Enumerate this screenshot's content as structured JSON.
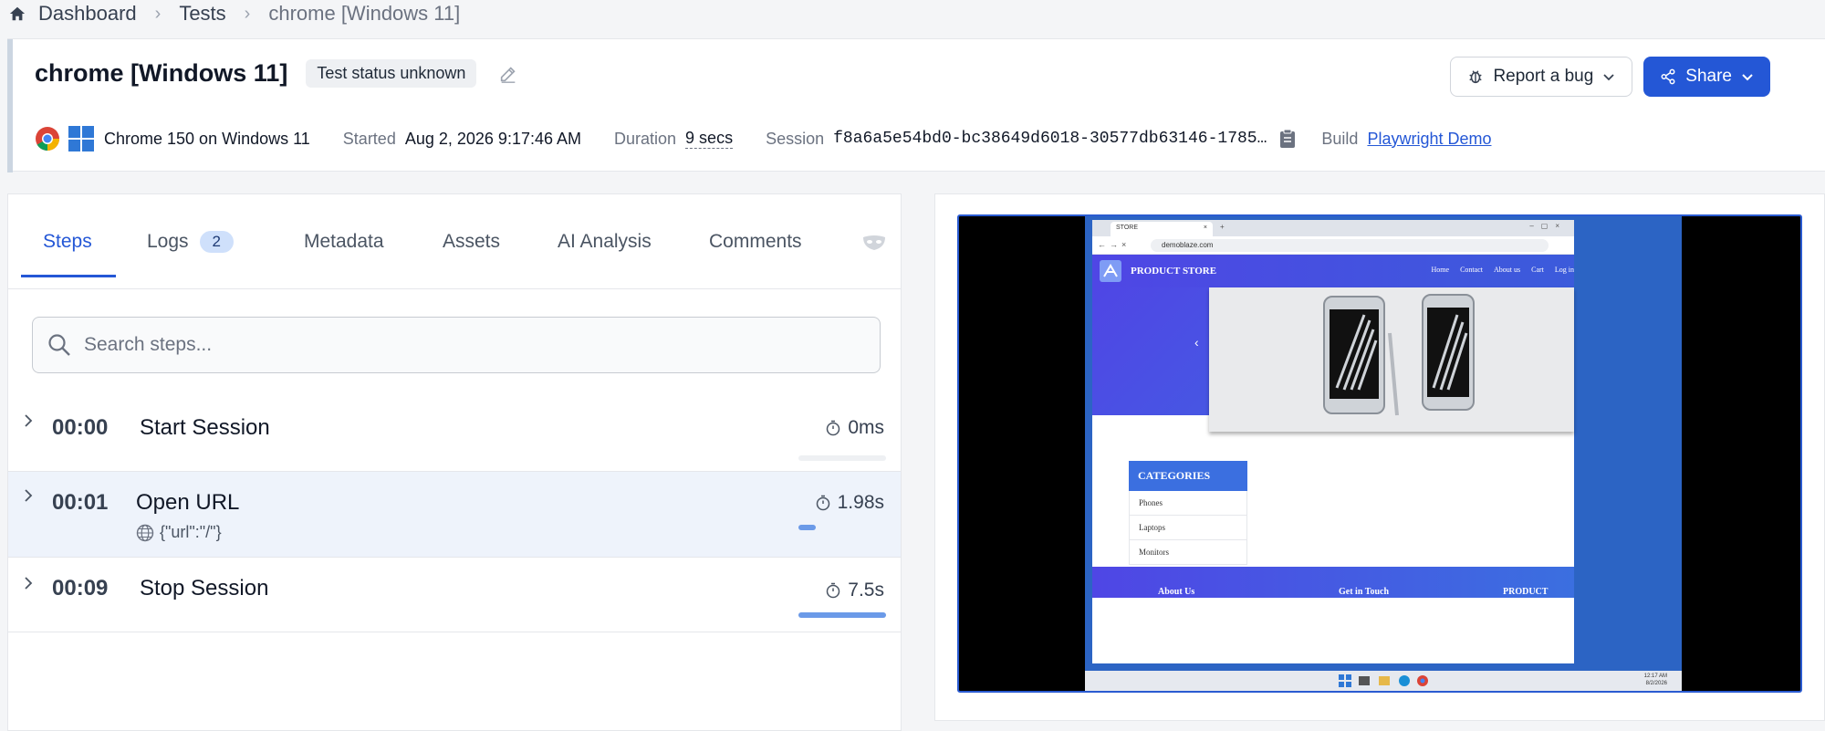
{
  "breadcrumb": {
    "items": [
      "Dashboard",
      "Tests"
    ],
    "current": "chrome [Windows 11]"
  },
  "header": {
    "title": "chrome [Windows 11]",
    "status": "Test status unknown",
    "report_bug_label": "Report a bug",
    "share_label": "Share",
    "browser_os": "Chrome 150 on Windows 11",
    "started_label": "Started",
    "started_value": "Aug 2, 2026 9:17:46 AM",
    "duration_label": "Duration",
    "duration_value": "9 secs",
    "session_label": "Session",
    "session_value": "f8a6a5e54bd0-bc38649d6018-30577db63146-1785…",
    "build_label": "Build",
    "build_value": "Playwright Demo"
  },
  "tabs": {
    "steps": "Steps",
    "logs": "Logs",
    "logs_count": "2",
    "metadata": "Metadata",
    "assets": "Assets",
    "ai": "AI Analysis",
    "comments": "Comments"
  },
  "search": {
    "placeholder": "Search steps..."
  },
  "steps": [
    {
      "time": "00:00",
      "name": "Start Session",
      "duration": "0ms",
      "progress": 0.0
    },
    {
      "time": "00:01",
      "name": "Open URL",
      "duration": "1.98s",
      "param": "{\"url\":\"/\"}",
      "progress": 0.2
    },
    {
      "time": "00:09",
      "name": "Stop Session",
      "duration": "7.5s",
      "progress": 1.0
    }
  ],
  "video": {
    "tab_title": "STORE",
    "url": "demoblaze.com",
    "brand": "PRODUCT STORE",
    "nav": [
      "Home",
      "Contact",
      "About us",
      "Cart",
      "Log in"
    ],
    "categories_header": "CATEGORIES",
    "categories": [
      "Phones",
      "Laptops",
      "Monitors"
    ],
    "footer": [
      "About Us",
      "Get in Touch",
      "PRODUCT STORE"
    ],
    "clock_time": "12:17 AM",
    "clock_date": "8/2/2026"
  },
  "colors": {
    "accent": "#2457d6",
    "badge_bg": "#cfe0fb",
    "selected_row": "#eef3fb"
  }
}
